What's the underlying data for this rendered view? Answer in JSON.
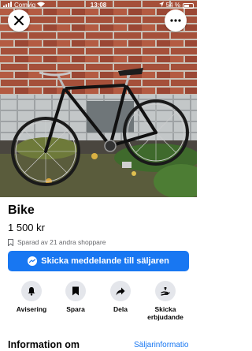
{
  "status_bar": {
    "carrier": "Comviq",
    "time": "13:08",
    "battery": "54 %"
  },
  "top_buttons": {
    "close_icon": "close-icon",
    "more_icon": "more-icon"
  },
  "listing": {
    "title": "Bike",
    "price": "1 500 kr",
    "saved_text": "Sparad av 21 andra shoppare"
  },
  "message_button": {
    "label": "Skicka meddelande till säljaren"
  },
  "actions": [
    {
      "label": "Avisering",
      "icon": "bell-icon"
    },
    {
      "label": "Spara",
      "icon": "bookmark-icon"
    },
    {
      "label": "Dela",
      "icon": "share-icon"
    },
    {
      "label": "Skicka erbjudande",
      "icon": "offer-icon"
    }
  ],
  "info_section": {
    "title": "Information om",
    "seller_link": "Säljarinformatio"
  },
  "colors": {
    "brand": "#1877f2",
    "secondary_button": "#e4e6eb",
    "muted_text": "#65676b"
  }
}
